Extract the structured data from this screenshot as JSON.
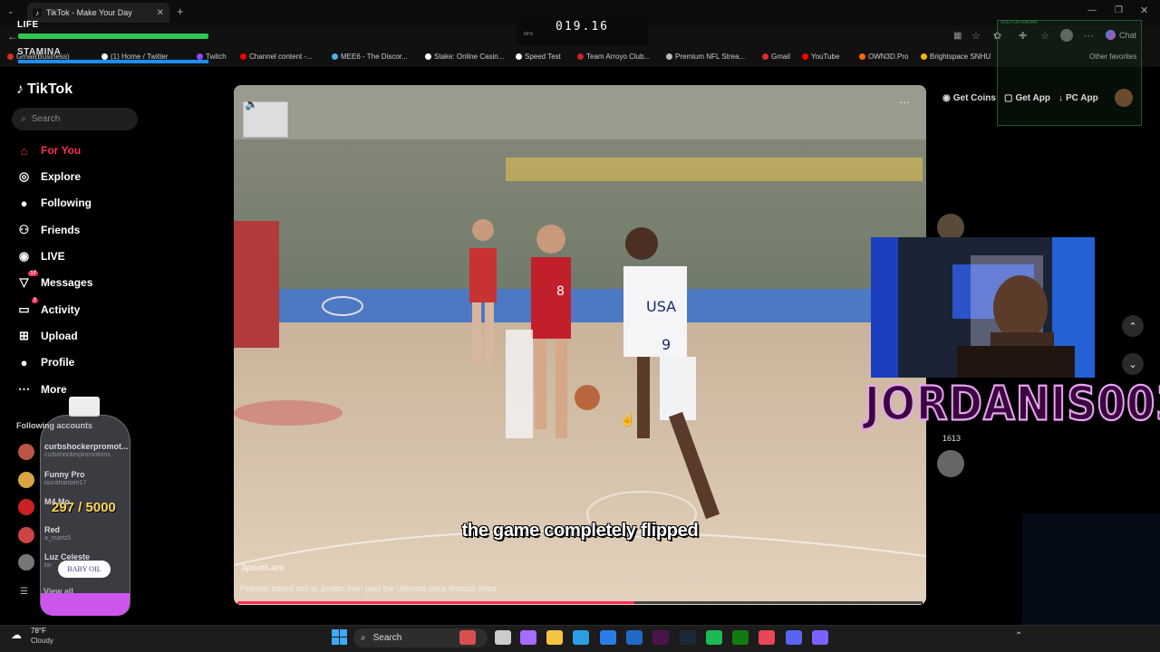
{
  "browser": {
    "tab_title": "TikTok - Make Your Day",
    "bookmarks": [
      {
        "label": "Gmail(Business)",
        "color": "#d93025"
      },
      {
        "label": "(1) Home / Twitter",
        "color": "#ffffff"
      },
      {
        "label": "Twitch",
        "color": "#9146ff"
      },
      {
        "label": "Channel content -...",
        "color": "#ff0000"
      },
      {
        "label": "MEE6 - The Discor...",
        "color": "#49b0e6"
      },
      {
        "label": "Stake: Online Casin...",
        "color": "#ffffff"
      },
      {
        "label": "Speed Test",
        "color": "#ffffff"
      },
      {
        "label": "Team Arroyo Club...",
        "color": "#cc2222"
      },
      {
        "label": "Premium NFL Strea...",
        "color": "#bbbbbb"
      },
      {
        "label": "Gmail",
        "color": "#d93025"
      },
      {
        "label": "YouTube",
        "color": "#ff0000"
      },
      {
        "label": "OWN3D.Pro",
        "color": "#ff6a00"
      },
      {
        "label": "Brightspace SNHU",
        "color": "#f7b500"
      }
    ],
    "other_favorites": "Other favorites",
    "chat": "Chat"
  },
  "hud": {
    "life": "LIFE",
    "stamina": "STAMINA",
    "clock": "019.16",
    "mhz": "MHz",
    "radar_title": "SOLITON RADAR"
  },
  "sidebar": {
    "logo": "TikTok",
    "search_placeholder": "Search",
    "nav": [
      {
        "label": "For You",
        "icon": "home-icon",
        "glyph": "⌂",
        "active": true
      },
      {
        "label": "Explore",
        "icon": "compass-icon",
        "glyph": "◎"
      },
      {
        "label": "Following",
        "icon": "following-avatar-icon",
        "glyph": "●"
      },
      {
        "label": "Friends",
        "icon": "friends-icon",
        "glyph": "⚇"
      },
      {
        "label": "LIVE",
        "icon": "live-icon",
        "glyph": "◉"
      },
      {
        "label": "Messages",
        "icon": "messages-icon",
        "glyph": "▽",
        "badge": "17"
      },
      {
        "label": "Activity",
        "icon": "activity-icon",
        "glyph": "▭",
        "badge": "7"
      },
      {
        "label": "Upload",
        "icon": "upload-icon",
        "glyph": "⊞"
      },
      {
        "label": "Profile",
        "icon": "profile-avatar-icon",
        "glyph": "●"
      },
      {
        "label": "More",
        "icon": "more-icon",
        "glyph": "⋯"
      }
    ],
    "following_title": "Following accounts",
    "accounts": [
      {
        "name": "curbshockerpromot...",
        "user": "curbshockerpromotions",
        "color": "#b54"
      },
      {
        "name": "Funny Pro",
        "user": "laurahansen17",
        "color": "#d9a441"
      },
      {
        "name": "M4 Mo",
        "user": "",
        "color": "#c22"
      },
      {
        "name": "Red",
        "user": "a_martz5",
        "color": "#c44"
      },
      {
        "name": "Luz Celeste",
        "user": "bo",
        "color": "#777"
      }
    ],
    "view_all": "View all"
  },
  "bottle": {
    "count": "297 / 5000",
    "label": "BABY OIL"
  },
  "video": {
    "subtitle": "the game completely flipped",
    "watermark": "3point.arc",
    "caption": "Petrovic talked shit to Jordan,then paid the Ultimate price #jordan #nba",
    "progress": 0.58
  },
  "topbar": {
    "get_coins": "Get Coins",
    "get_app": "Get App",
    "pc_app": "PC App"
  },
  "actions": {
    "count": "1613"
  },
  "overlay": {
    "streamer_name": "JORDANIS003"
  },
  "taskbar": {
    "temp": "78°F",
    "weather": "Cloudy",
    "search": "Search"
  }
}
